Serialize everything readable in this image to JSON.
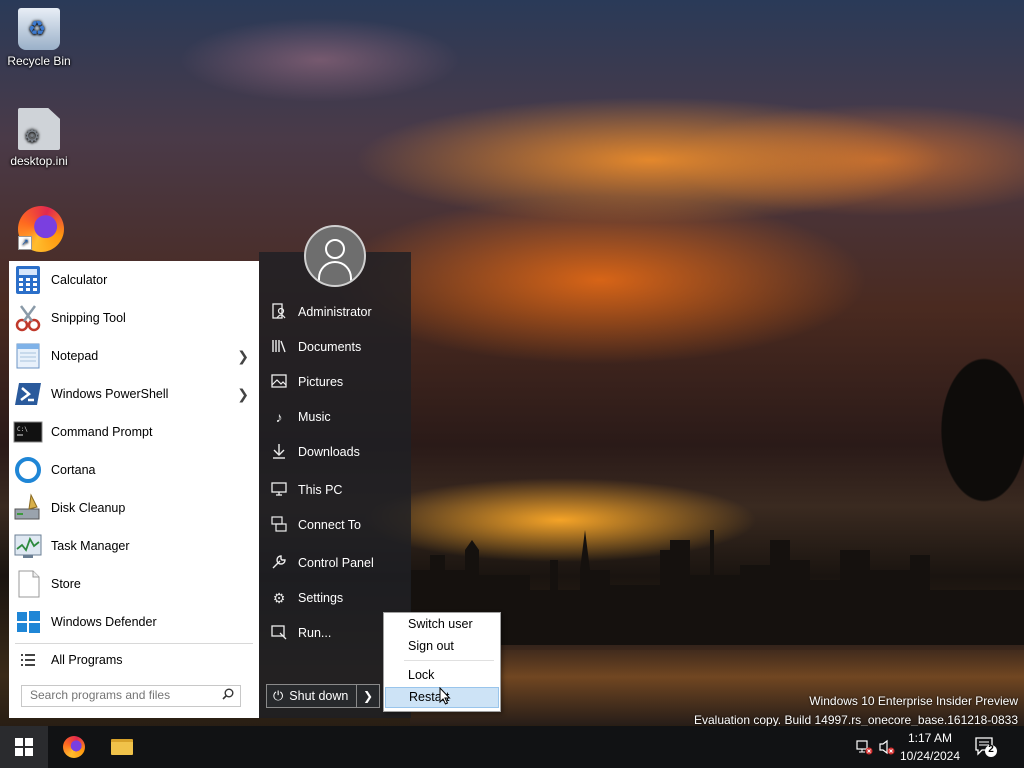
{
  "desktop": {
    "icons": [
      {
        "label": "Recycle Bin"
      },
      {
        "label": "desktop.ini"
      },
      {
        "label": ""
      }
    ],
    "watermark": {
      "line1": "Windows 10 Enterprise Insider Preview",
      "line2": "Evaluation copy. Build 14997.rs_onecore_base.161218-0833"
    }
  },
  "start_menu": {
    "pinned": [
      {
        "label": "Calculator",
        "icon": "calculator-icon"
      },
      {
        "label": "Snipping Tool",
        "icon": "scissors-icon"
      },
      {
        "label": "Notepad",
        "icon": "notepad-icon",
        "has_submenu": true
      },
      {
        "label": "Windows PowerShell",
        "icon": "powershell-icon",
        "has_submenu": true
      },
      {
        "label": "Command Prompt",
        "icon": "cmd-icon"
      },
      {
        "label": "Cortana",
        "icon": "cortana-icon"
      },
      {
        "label": "Disk Cleanup",
        "icon": "disk-cleanup-icon"
      },
      {
        "label": "Task Manager",
        "icon": "task-manager-icon"
      },
      {
        "label": "Store",
        "icon": "store-icon"
      },
      {
        "label": "Windows Defender",
        "icon": "windows-defender-icon"
      }
    ],
    "all_programs": "All Programs",
    "search_placeholder": "Search programs and files",
    "right": [
      {
        "label": "Administrator",
        "icon": "user-folder-icon"
      },
      {
        "label": "Documents",
        "icon": "documents-icon"
      },
      {
        "label": "Pictures",
        "icon": "pictures-icon"
      },
      {
        "label": "Music",
        "icon": "music-icon"
      },
      {
        "label": "Downloads",
        "icon": "downloads-icon"
      },
      {
        "label": "This PC",
        "icon": "computer-icon"
      },
      {
        "label": "Connect To",
        "icon": "connect-icon"
      },
      {
        "label": "Control Panel",
        "icon": "control-panel-icon"
      },
      {
        "label": "Settings",
        "icon": "gear-icon"
      },
      {
        "label": "Run...",
        "icon": "run-icon"
      }
    ],
    "shutdown_label": "Shut down",
    "power_menu": [
      {
        "label": "Switch user"
      },
      {
        "label": "Sign out"
      },
      {
        "label": "Lock"
      },
      {
        "label": "Restart",
        "hovered": true
      }
    ]
  },
  "taskbar": {
    "apps": [
      "start-icon",
      "firefox-icon",
      "file-explorer-icon"
    ],
    "clock": {
      "time": "1:17 AM",
      "date": "10/24/2024"
    },
    "notification_count": "2"
  }
}
